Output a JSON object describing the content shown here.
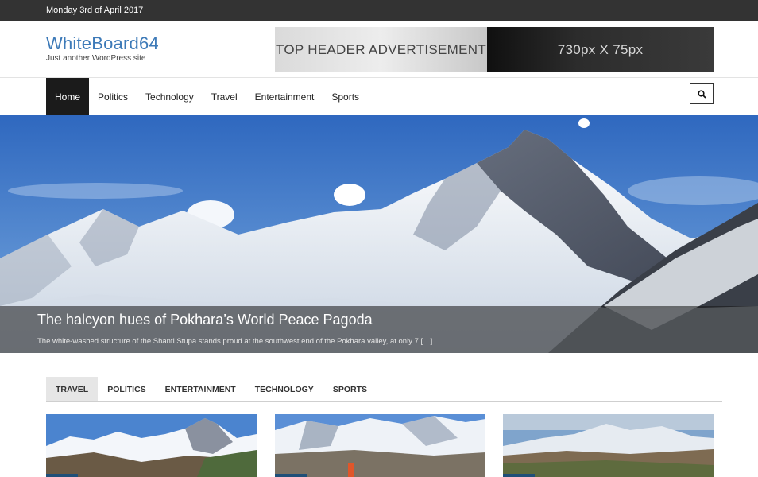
{
  "topbar": {
    "date": "Monday 3rd of April 2017"
  },
  "site": {
    "title": "WhiteBoard64",
    "tagline": "Just another WordPress site"
  },
  "ad": {
    "left_text": "TOP HEADER ADVERTISEMENT",
    "right_text": "730px X 75px"
  },
  "nav": {
    "items": [
      {
        "label": "Home",
        "active": true
      },
      {
        "label": "Politics"
      },
      {
        "label": "Technology"
      },
      {
        "label": "Travel"
      },
      {
        "label": "Entertainment"
      },
      {
        "label": "Sports"
      }
    ],
    "search_icon": "search-icon"
  },
  "hero": {
    "title": "The halcyon hues of Pokhara’s World Peace Pagoda",
    "excerpt": "The white-washed structure of the Shanti Stupa stands proud at the southwest end of the Pokhara valley, at only 7 […]"
  },
  "tabs": [
    {
      "label": "TRAVEL",
      "active": true
    },
    {
      "label": "POLITICS"
    },
    {
      "label": "ENTERTAINMENT"
    },
    {
      "label": "TECHNOLOGY"
    },
    {
      "label": "SPORTS"
    }
  ],
  "colors": {
    "brand": "#3d7ab8",
    "topbar": "#333333",
    "nav_active": "#1b1b1b",
    "tag": "#1f4f78"
  }
}
